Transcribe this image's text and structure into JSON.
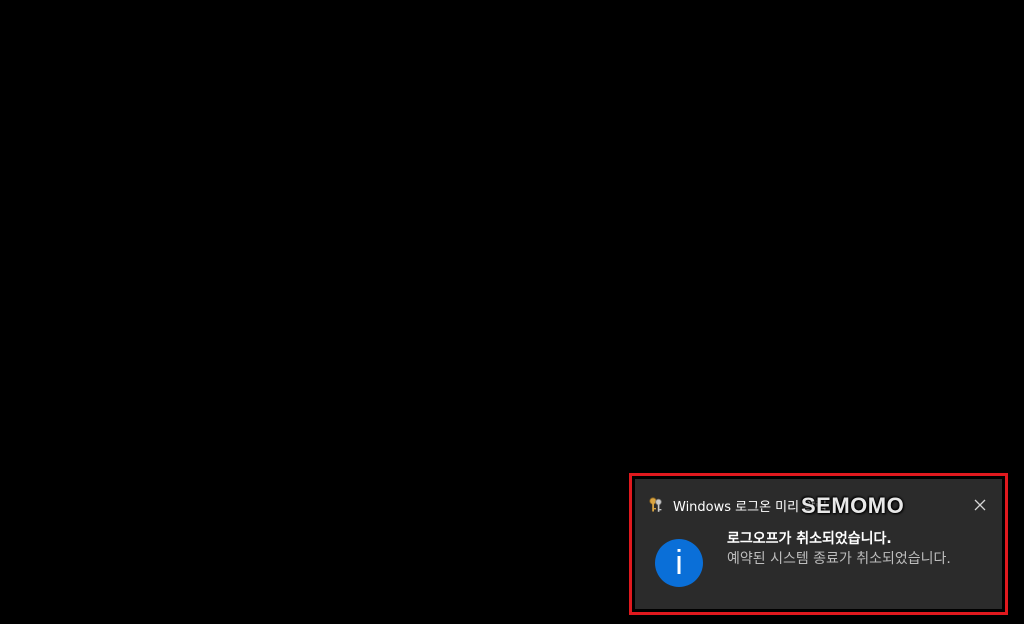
{
  "toast": {
    "app_name": "Windows 로그온 미리 알림",
    "app_icon": "keys-icon",
    "title": "로그오프가 취소되었습니다.",
    "message": "예약된 시스템 종료가 취소되었습니다.",
    "status_icon": "info-icon",
    "status_glyph": "i",
    "close_icon": "close-icon"
  },
  "watermark": {
    "text": "SEMOMO"
  },
  "colors": {
    "desktop_background": "#000000",
    "toast_background": "#2b2b2b",
    "highlight_border": "#e0191e",
    "info_accent": "#0a6fd8",
    "title_text": "#ffffff",
    "message_text": "#bdbdbd"
  }
}
